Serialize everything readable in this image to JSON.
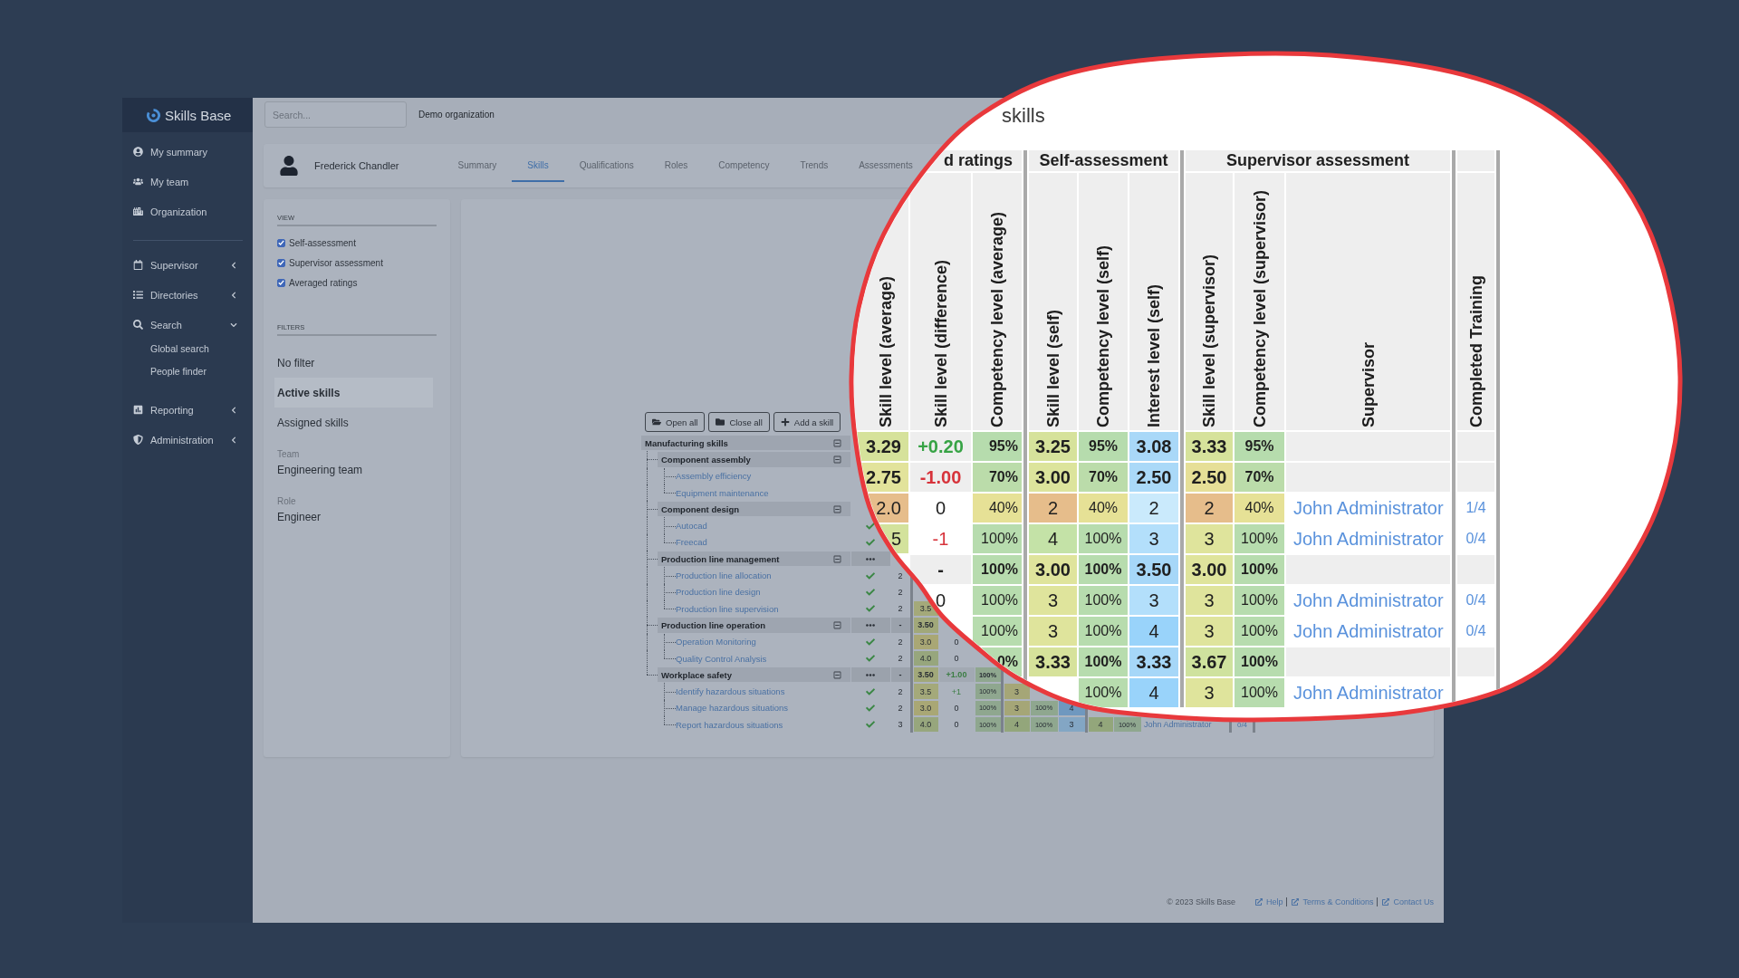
{
  "sidebar": {
    "logo": "Skills Base",
    "groups": [
      {
        "items": [
          {
            "label": "My summary"
          },
          {
            "label": "My team"
          },
          {
            "label": "Organization"
          }
        ]
      },
      {
        "items": [
          {
            "label": "Supervisor",
            "expanded": false
          },
          {
            "label": "Directories",
            "expanded": false
          },
          {
            "label": "Search",
            "expanded": true,
            "children": [
              {
                "label": "Global search"
              },
              {
                "label": "People finder"
              }
            ]
          },
          {
            "label": "Reporting",
            "expanded": false
          },
          {
            "label": "Administration",
            "expanded": false
          }
        ]
      }
    ]
  },
  "topbar": {
    "search": {
      "placeholder": "Search..."
    },
    "organization": "Demo organization"
  },
  "profile": {
    "name": "Frederick Chandler",
    "tabs": [
      {
        "label": "Summary",
        "selected": false
      },
      {
        "label": "Skills",
        "selected": true
      },
      {
        "label": "Qualifications",
        "selected": false
      },
      {
        "label": "Roles",
        "selected": false
      },
      {
        "label": "Competency",
        "selected": false
      },
      {
        "label": "Trends",
        "selected": false
      },
      {
        "label": "Assessments",
        "selected": false
      }
    ]
  },
  "view": {
    "title": "VIEW",
    "options": [
      {
        "label": "Self-assessment",
        "checked": true
      },
      {
        "label": "Supervisor assessment",
        "checked": true
      },
      {
        "label": "Averaged ratings",
        "checked": true
      }
    ]
  },
  "filters": {
    "title": "FILTERS",
    "options": [
      {
        "label": "No filter",
        "selected": false
      },
      {
        "label": "Active skills",
        "selected": true
      },
      {
        "label": "Assigned skills",
        "selected": false
      }
    ],
    "fields": [
      {
        "label": "Team",
        "value": "Engineering team"
      },
      {
        "label": "Role",
        "value": "Engineer"
      }
    ]
  },
  "skills_panel": {
    "buttons": [
      {
        "label": "Open all"
      },
      {
        "label": "Close all"
      },
      {
        "label": "Add a skill"
      }
    ],
    "tree": [
      {
        "name": "Manufacturing skills",
        "kind": "group",
        "expanded": true,
        "children": [
          {
            "name": "Component assembly",
            "kind": "group",
            "expanded": true,
            "children": [
              {
                "name": "Assembly efficiency",
                "kind": "skill"
              },
              {
                "name": "Equipment maintenance",
                "kind": "skill"
              }
            ]
          },
          {
            "name": "Component design",
            "kind": "group",
            "expanded": true,
            "children": [
              {
                "name": "Autocad",
                "kind": "skill",
                "cells": {
                  "status": {
                    "kind": "check"
                  }
                }
              },
              {
                "name": "Freecad",
                "kind": "skill",
                "cells": {
                  "status": {
                    "kind": "check"
                  }
                }
              }
            ]
          },
          {
            "name": "Production line management",
            "kind": "group",
            "expanded": true,
            "cells": {
              "status": {
                "kind": "menu"
              }
            },
            "children": [
              {
                "name": "Production line allocation",
                "kind": "skill",
                "cells": {
                  "status": {
                    "kind": "check"
                  },
                  "count": "2"
                }
              },
              {
                "name": "Production line design",
                "kind": "skill",
                "cells": {
                  "status": {
                    "kind": "check"
                  },
                  "count": "2"
                }
              },
              {
                "name": "Production line supervision",
                "kind": "skill",
                "cells": {
                  "status": {
                    "kind": "check"
                  },
                  "count": "2",
                  "skill_average": {
                    "text": "3.5",
                    "color": "#a4a97a"
                  }
                }
              }
            ]
          },
          {
            "name": "Production line operation",
            "kind": "group",
            "expanded": true,
            "cells": {
              "status": {
                "kind": "menu"
              },
              "count": "-",
              "skill_average": {
                "text": "3.50",
                "color": "#a1a87a"
              }
            },
            "children": [
              {
                "name": "Operation Monitoring",
                "kind": "skill",
                "cells": {
                  "status": {
                    "kind": "check"
                  },
                  "count": "2",
                  "skill_average": {
                    "text": "3.0",
                    "color": "#a9a775"
                  },
                  "skill_difference": {
                    "text": "0",
                    "kind": "neutral"
                  }
                }
              },
              {
                "name": "Quality Control Analysis",
                "kind": "skill",
                "cells": {
                  "status": {
                    "kind": "check"
                  },
                  "count": "2",
                  "skill_average": {
                    "text": "4.0",
                    "color": "#97a67d"
                  },
                  "skill_difference": {
                    "text": "0",
                    "kind": "neutral"
                  }
                }
              }
            ]
          },
          {
            "name": "Workplace safety",
            "kind": "group",
            "expanded": true,
            "cells": {
              "status": {
                "kind": "menu"
              },
              "count": "-",
              "skill_average": {
                "text": "3.50",
                "color": "#a1a87a"
              },
              "skill_difference": {
                "text": "+1.00",
                "kind": "positive"
              },
              "competency_average": {
                "text": "100%",
                "color": "#8fa78f"
              }
            },
            "children": [
              {
                "name": "Identify hazardous situations",
                "kind": "skill",
                "cells": {
                  "status": {
                    "kind": "check"
                  },
                  "count": "2",
                  "skill_average": {
                    "text": "3.5",
                    "color": "#a4a97a"
                  },
                  "skill_difference": {
                    "text": "+1",
                    "kind": "positive"
                  },
                  "competency_average": {
                    "text": "100%",
                    "color": "#8fa78f"
                  },
                  "skill_self": {
                    "text": "3",
                    "color": "#a5a677"
                  }
                }
              },
              {
                "name": "Manage hazardous situations",
                "kind": "skill",
                "cells": {
                  "status": {
                    "kind": "check"
                  },
                  "count": "2",
                  "skill_average": {
                    "text": "3.0",
                    "color": "#a9a775"
                  },
                  "skill_difference": {
                    "text": "0",
                    "kind": "neutral"
                  },
                  "competency_average": {
                    "text": "100%",
                    "color": "#8fa78f"
                  },
                  "skill_self": {
                    "text": "3",
                    "color": "#a5a677"
                  },
                  "competency_self": {
                    "text": "100%",
                    "color": "#8fa78f"
                  },
                  "interest_self": {
                    "text": "4",
                    "color": "#6f98bf"
                  }
                }
              },
              {
                "name": "Report hazardous situations",
                "kind": "skill",
                "cells": {
                  "status": {
                    "kind": "check"
                  },
                  "count": "3",
                  "skill_average": {
                    "text": "4.0",
                    "color": "#97a67d"
                  },
                  "skill_difference": {
                    "text": "0",
                    "kind": "neutral"
                  },
                  "competency_average": {
                    "text": "100%",
                    "color": "#8fa78f"
                  },
                  "skill_self": {
                    "text": "4",
                    "color": "#93a67b"
                  },
                  "competency_self": {
                    "text": "100%",
                    "color": "#8fa78f"
                  },
                  "interest_self": {
                    "text": "3",
                    "color": "#83a6c4"
                  },
                  "skill_supervisor": {
                    "text": "4",
                    "color": "#93a67b"
                  },
                  "competency_supervisor": {
                    "text": "100%",
                    "color": "#8fa78f"
                  },
                  "supervisor": "John Administrator",
                  "completed_training": "0/4"
                }
              }
            ]
          }
        ]
      }
    ]
  },
  "magnifier": {
    "title": "skills",
    "column_groups": [
      {
        "label": "d ratings"
      },
      {
        "label": "Self-assessment"
      },
      {
        "label": "Supervisor assessment"
      }
    ],
    "columns": [
      "Skill level (average)",
      "Skill level (difference)",
      "Competency level (average)",
      "Skill level (self)",
      "Competency level (self)",
      "Interest level (self)",
      "Skill level (supervisor)",
      "Competency level (supervisor)",
      "Supervisor",
      "Completed Training"
    ],
    "rows": [
      {
        "kind": "group",
        "cells": {
          "skill_average": {
            "text": "3.29",
            "color": "#d6e29b"
          },
          "skill_difference": {
            "text": "+0.20",
            "color": "#37a345"
          },
          "competency_average": {
            "text": "95%",
            "color": "#b6dcad"
          },
          "skill_self": {
            "text": "3.25",
            "color": "#d6e29b"
          },
          "competency_self": {
            "text": "95%",
            "color": "#b6dcad"
          },
          "interest_self": {
            "text": "3.08",
            "color": "#a9d8f8"
          },
          "skill_supervisor": {
            "text": "3.33",
            "color": "#d6e29b"
          },
          "competency_supervisor": {
            "text": "95%",
            "color": "#b6dcad"
          }
        }
      },
      {
        "kind": "group",
        "cells": {
          "skill_average": {
            "text": "2.75",
            "color": "#e2e39b"
          },
          "skill_difference": {
            "text": "-1.00",
            "color": "#d7333b"
          },
          "competency_average": {
            "text": "70%",
            "color": "#bbdcaa"
          },
          "skill_self": {
            "text": "3.00",
            "color": "#dce49c"
          },
          "competency_self": {
            "text": "70%",
            "color": "#bbdcaa"
          },
          "interest_self": {
            "text": "2.50",
            "color": "#aad9f8"
          },
          "skill_supervisor": {
            "text": "2.50",
            "color": "#e6df97"
          },
          "competency_supervisor": {
            "text": "70%",
            "color": "#bbdcaa"
          }
        }
      },
      {
        "kind": "skill",
        "cells": {
          "skill_average": {
            "text": "2.0",
            "color": "#e6bd8b"
          },
          "skill_difference": {
            "text": "0",
            "color": "#222222"
          },
          "competency_average": {
            "text": "40%",
            "color": "#e6e196"
          },
          "skill_self": {
            "text": "2",
            "color": "#e6bd8b"
          },
          "competency_self": {
            "text": "40%",
            "color": "#e6e196"
          },
          "interest_self": {
            "text": "2",
            "color": "#caeafc"
          },
          "skill_supervisor": {
            "text": "2",
            "color": "#e6bd8b"
          },
          "competency_supervisor": {
            "text": "40%",
            "color": "#e6e196"
          },
          "supervisor": "John Administrator",
          "completed_training": "1/4"
        }
      },
      {
        "kind": "skill",
        "cells": {
          "skill_average": {
            "text": "5",
            "color": "#d3e29c"
          },
          "skill_difference": {
            "text": "-1",
            "color": "#d7333b"
          },
          "competency_average": {
            "text": "100%",
            "color": "#b7dcae"
          },
          "skill_self": {
            "text": "4",
            "color": "#c4e2a7"
          },
          "competency_self": {
            "text": "100%",
            "color": "#b7dcae"
          },
          "interest_self": {
            "text": "3",
            "color": "#b3dffb"
          },
          "skill_supervisor": {
            "text": "3",
            "color": "#dfe49c"
          },
          "competency_supervisor": {
            "text": "100%",
            "color": "#b7dcae"
          },
          "supervisor": "John Administrator",
          "completed_training": "0/4"
        }
      },
      {
        "kind": "group",
        "cells": {
          "skill_difference": {
            "text": "-",
            "color": "#222222"
          },
          "competency_average": {
            "text": "100%",
            "color": "#b7dcae"
          },
          "skill_self": {
            "text": "3.00",
            "color": "#dfe49c"
          },
          "competency_self": {
            "text": "100%",
            "color": "#b7dcae"
          },
          "interest_self": {
            "text": "3.50",
            "color": "#a6d7f8"
          },
          "skill_supervisor": {
            "text": "3.00",
            "color": "#dfe49c"
          },
          "competency_supervisor": {
            "text": "100%",
            "color": "#b7dcae"
          }
        }
      },
      {
        "kind": "skill",
        "cells": {
          "skill_difference": {
            "text": "0",
            "color": "#222222"
          },
          "competency_average": {
            "text": "100%",
            "color": "#b7dcae"
          },
          "skill_self": {
            "text": "3",
            "color": "#dfe49c"
          },
          "competency_self": {
            "text": "100%",
            "color": "#b7dcae"
          },
          "interest_self": {
            "text": "3",
            "color": "#b3dffb"
          },
          "skill_supervisor": {
            "text": "3",
            "color": "#dfe49c"
          },
          "competency_supervisor": {
            "text": "100%",
            "color": "#b7dcae"
          },
          "supervisor": "John Administrator",
          "completed_training": "0/4"
        }
      },
      {
        "kind": "skill",
        "cells": {
          "competency_average": {
            "text": "100%",
            "color": "#b7dcae"
          },
          "skill_self": {
            "text": "3",
            "color": "#dfe49c"
          },
          "competency_self": {
            "text": "100%",
            "color": "#b7dcae"
          },
          "interest_self": {
            "text": "4",
            "color": "#99d3fa"
          },
          "skill_supervisor": {
            "text": "3",
            "color": "#dfe49c"
          },
          "competency_supervisor": {
            "text": "100%",
            "color": "#b7dcae"
          },
          "supervisor": "John Administrator",
          "completed_training": "0/4"
        }
      },
      {
        "kind": "group",
        "cells": {
          "competency_average": {
            "text": "0%",
            "color": "#b7dcae"
          },
          "skill_self": {
            "text": "3.33",
            "color": "#d6e29b"
          },
          "competency_self": {
            "text": "100%",
            "color": "#b7dcae"
          },
          "interest_self": {
            "text": "3.33",
            "color": "#a6d7f8"
          },
          "skill_supervisor": {
            "text": "3.67",
            "color": "#cfe29e"
          },
          "competency_supervisor": {
            "text": "100%",
            "color": "#b7dcae"
          }
        }
      },
      {
        "kind": "skill",
        "cells": {
          "competency_self": {
            "text": "100%",
            "color": "#b7dcae"
          },
          "interest_self": {
            "text": "4",
            "color": "#99d3fa"
          },
          "skill_supervisor": {
            "text": "3",
            "color": "#dfe49c"
          },
          "competency_supervisor": {
            "text": "100%",
            "color": "#b7dcae"
          },
          "supervisor": "John Administrator"
        }
      }
    ]
  },
  "footer": {
    "copyright": "© 2023 Skills Base",
    "links": [
      "Help",
      "Terms & Conditions",
      "Contact Us"
    ]
  }
}
